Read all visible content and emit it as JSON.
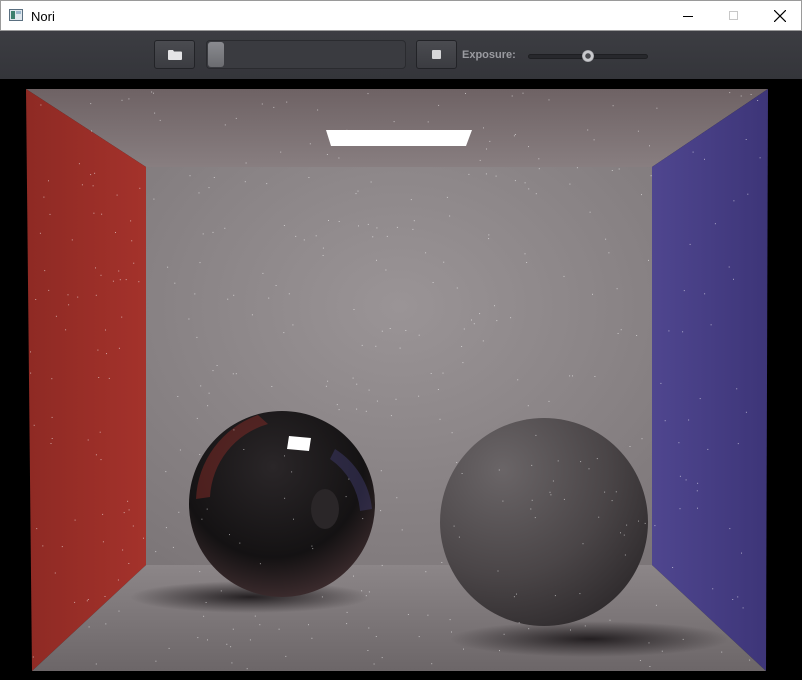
{
  "window": {
    "title": "Nori"
  },
  "toolbar": {
    "open_icon": "folder-icon",
    "stop_icon": "stop-icon",
    "render_progress": 0.05,
    "exposure_label": "Exposure:",
    "exposure_value": 0.5
  },
  "colors": {
    "toolbar_bg": "#3c3d42",
    "left_wall": "#9a2b25",
    "right_wall": "#53479a",
    "back_wall": "#8f8a8c",
    "light": "#ffffff"
  }
}
